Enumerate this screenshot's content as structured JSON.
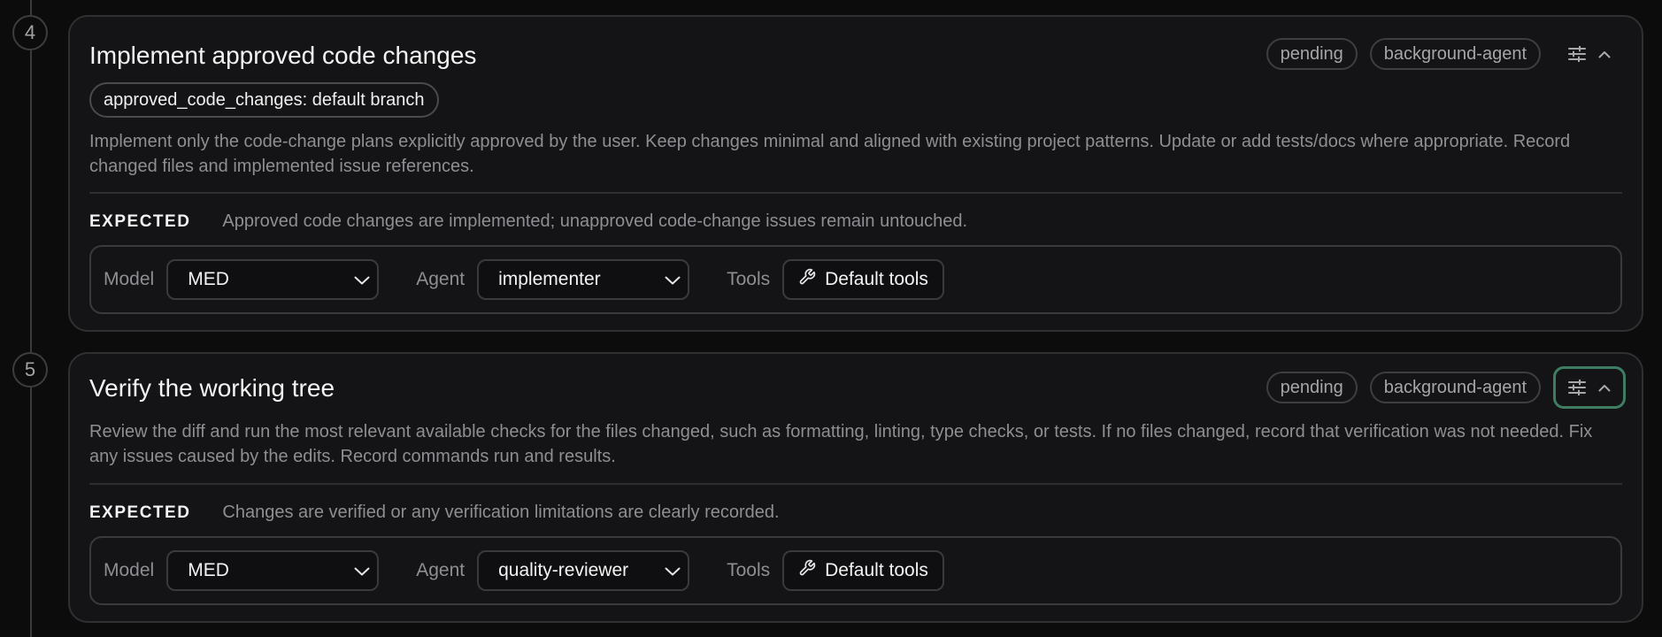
{
  "steps": [
    {
      "number": "4",
      "title": "Implement approved code changes",
      "status": "pending",
      "runner": "background-agent",
      "tag": "approved_code_changes: default branch",
      "description": "Implement only the code-change plans explicitly approved by the user. Keep changes minimal and aligned with existing project patterns. Update or add tests/docs where appropriate. Record changed files and implemented issue references.",
      "expected_label": "EXPECTED",
      "expected": "Approved code changes are implemented; unapproved code-change issues remain untouched.",
      "model_label": "Model",
      "model": "MED",
      "agent_label": "Agent",
      "agent": "implementer",
      "tools_label": "Tools",
      "tools": "Default tools"
    },
    {
      "number": "5",
      "title": "Verify the working tree",
      "status": "pending",
      "runner": "background-agent",
      "description": "Review the diff and run the most relevant available checks for the files changed, such as formatting, linting, type checks, or tests. If no files changed, record that verification was not needed. Fix any issues caused by the edits. Record commands run and results.",
      "expected_label": "EXPECTED",
      "expected": "Changes are verified or any verification limitations are clearly recorded.",
      "model_label": "Model",
      "model": "MED",
      "agent_label": "Agent",
      "agent": "quality-reviewer",
      "tools_label": "Tools",
      "tools": "Default tools"
    }
  ],
  "icons": {
    "settings": "sliders-icon",
    "collapse": "chevron-up-icon",
    "dropdown": "chevron-down-icon",
    "tools": "wrench-icon"
  },
  "colors": {
    "focus_ring": "#3f7d63",
    "background": "#0c0c0d",
    "card": "#141416"
  }
}
